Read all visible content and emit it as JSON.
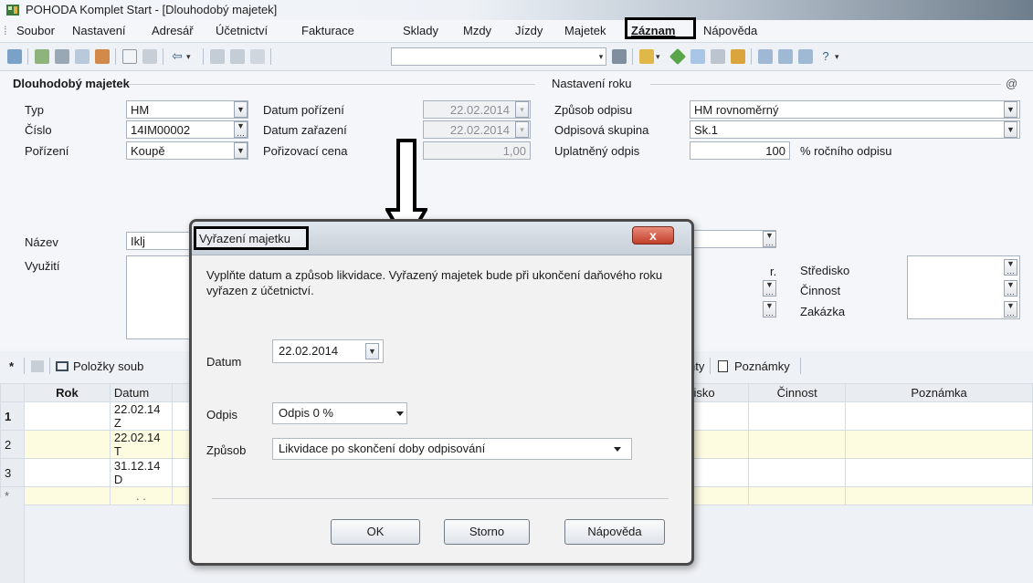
{
  "window": {
    "title": "POHODA Komplet Start - [Dlouhodobý majetek]"
  },
  "menu": [
    "Soubor",
    "Nastavení",
    "Adresář",
    "Účetnictví",
    "Fakturace",
    "Sklady",
    "Mzdy",
    "Jízdy",
    "Majetek",
    "Záznam",
    "Nápověda"
  ],
  "form": {
    "section_left": "Dlouhodobý majetek",
    "section_right": "Nastavení roku",
    "at_sign": "@",
    "typ_label": "Typ",
    "typ_value": "HM",
    "cislo_label": "Číslo",
    "cislo_value": "14IM00002",
    "porizeni_label": "Pořízení",
    "porizeni_value": "Koupě",
    "datum_porizeni_label": "Datum pořízení",
    "datum_porizeni_value": "22.02.2014",
    "datum_zarazeni_label": "Datum zařazení",
    "datum_zarazeni_value": "22.02.2014",
    "porizovaci_cena_label": "Pořizovací cena",
    "porizovaci_cena_value": "1,00",
    "zpusob_odpisu_label": "Způsob odpisu",
    "zpusob_odpisu_value": "HM rovnoměrný",
    "odpisova_skupina_label": "Odpisová skupina",
    "odpisova_skupina_value": "Sk.1",
    "uplatneny_odpis_label": "Uplatněný odpis",
    "uplatneny_odpis_value": "100",
    "uplatneny_odpis_unit": "% ročního odpisu",
    "nazev_label": "Název",
    "nazev_value": "Iklj",
    "vyuziti_label": "Využití",
    "r_label": "r.",
    "stredisko_label": "Středisko",
    "cinnost_label": "Činnost",
    "zakazka_label": "Zakázka"
  },
  "grid": {
    "tabs": {
      "star": "*",
      "polozky": "Položky soub",
      "dokumenty": "nty",
      "poznamky": "Poznámky"
    },
    "headers": {
      "rok": "Rok",
      "datum": "Datum",
      "stredisko": "disko",
      "cinnost": "Činnost",
      "poznamka": "Poznámka"
    },
    "rows": [
      {
        "num": "1",
        "datum": "22.02.14",
        "txt": "Z"
      },
      {
        "num": "2",
        "datum": "22.02.14",
        "txt": "T"
      },
      {
        "num": "3",
        "datum": "31.12.14",
        "txt": "D"
      },
      {
        "num": "*",
        "datum": ". .",
        "txt": ""
      }
    ]
  },
  "dialog": {
    "title": "Vyřazení majetku",
    "close": "x",
    "instruction": "Vyplňte datum a způsob likvidace. Vyřazený majetek bude při ukončení daňového roku vyřazen z účetnictví.",
    "datum_label": "Datum",
    "datum_value": "22.02.2014",
    "odpis_label": "Odpis",
    "odpis_value": "Odpis 0 %",
    "zpusob_label": "Způsob",
    "zpusob_value": "Likvidace po skončení doby odpisování",
    "ok": "OK",
    "storno": "Storno",
    "napoveda": "Nápověda"
  }
}
